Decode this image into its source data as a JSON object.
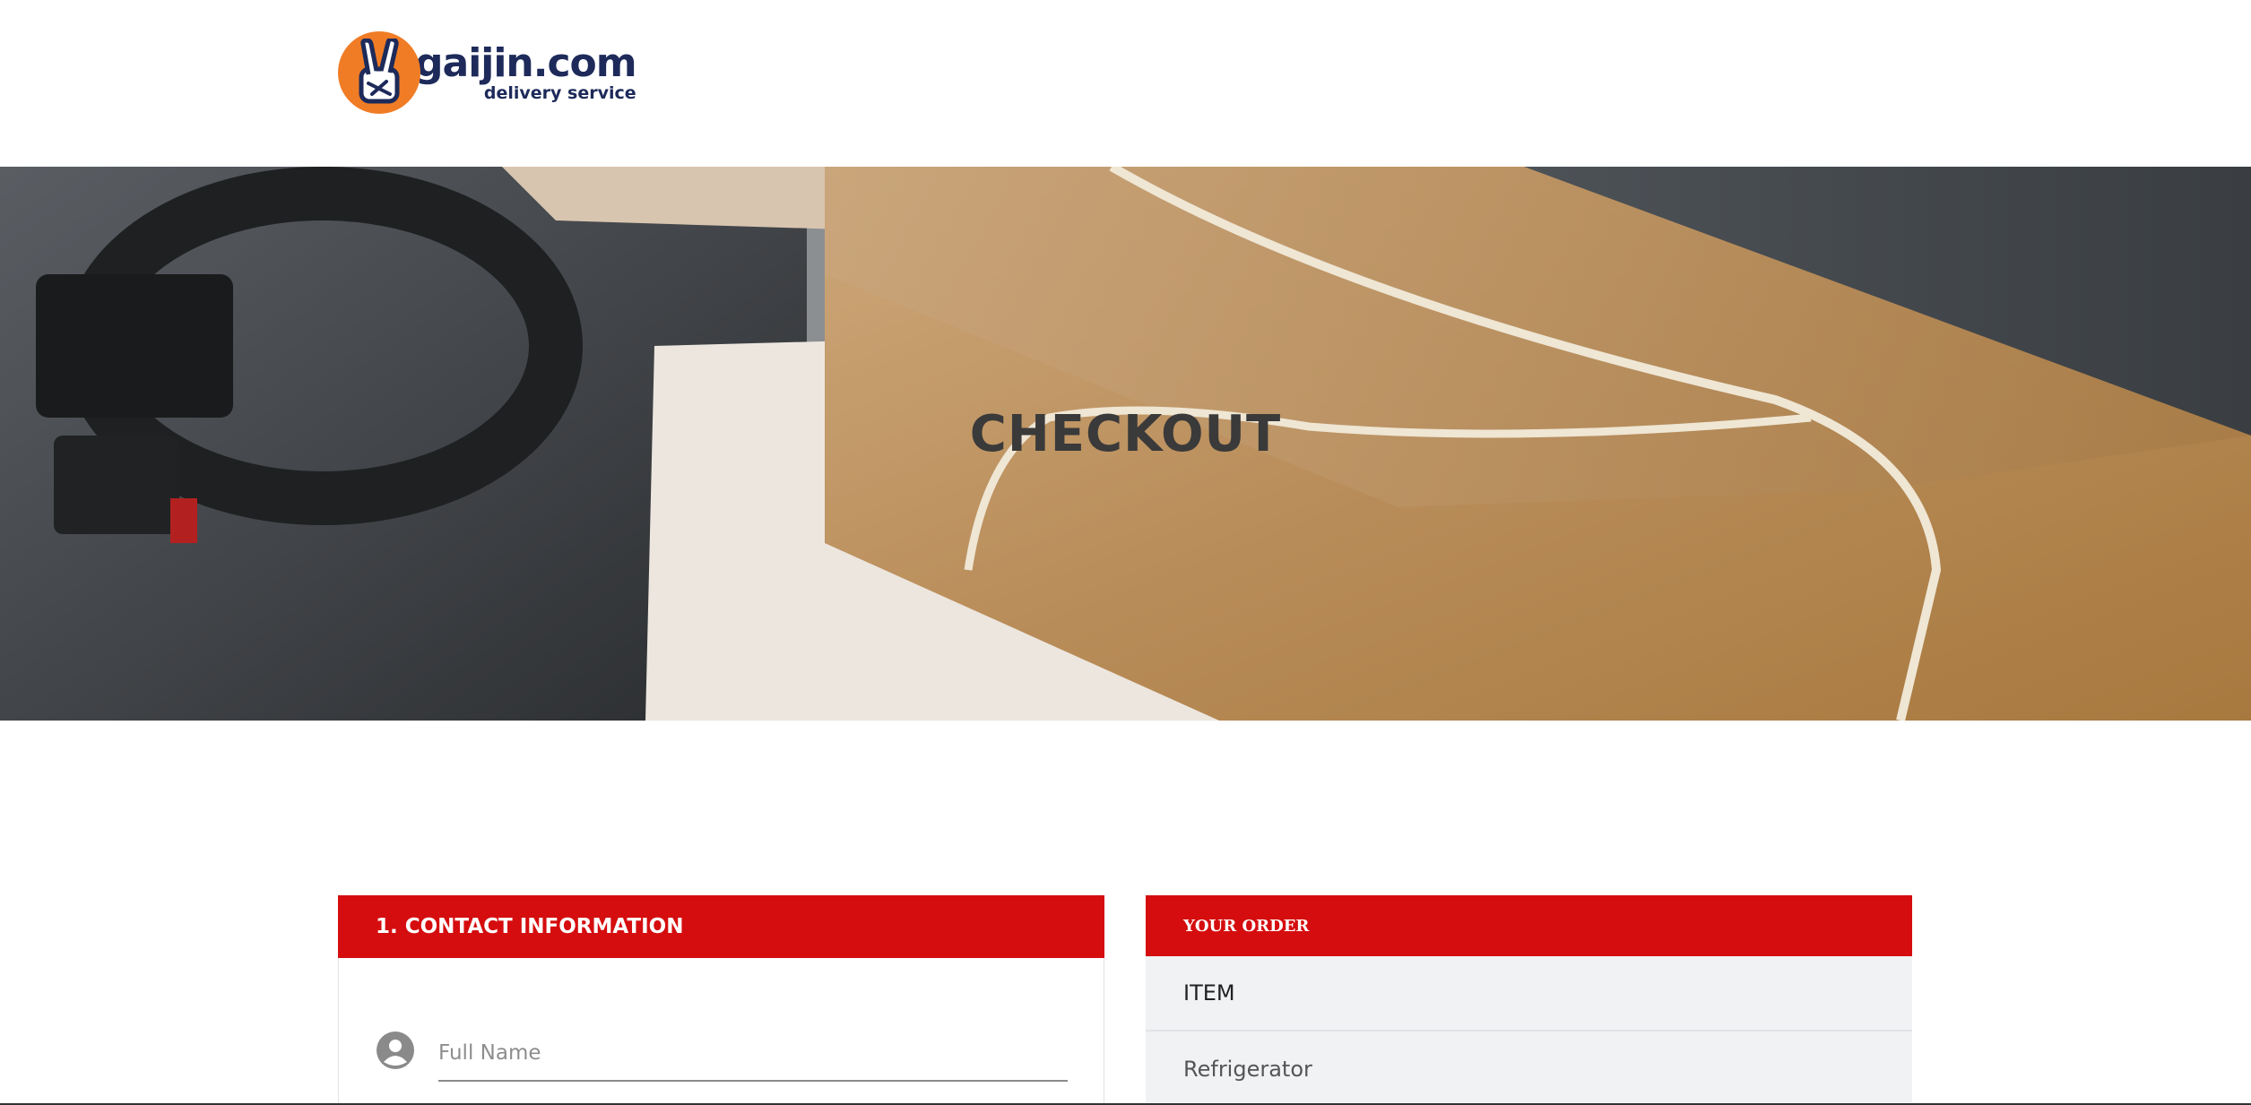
{
  "header": {
    "logo": {
      "name": "gaijin.com",
      "tagline": "delivery service",
      "icon": "peace-hand-icon",
      "color_circle": "#f07c26",
      "color_text": "#1d2a5a"
    }
  },
  "hero": {
    "title": "CHECKOUT",
    "background": "delivery-box-photo"
  },
  "contact": {
    "heading": "1. CONTACT INFORMATION",
    "full_name": {
      "placeholder": "Full Name",
      "value": "",
      "icon": "user-icon"
    }
  },
  "order": {
    "heading": "YOUR ORDER",
    "column_label": "ITEM",
    "items": [
      "Refrigerator"
    ]
  },
  "colors": {
    "accent": "#d50d0f",
    "order_panel_bg": "#f1f2f4"
  }
}
